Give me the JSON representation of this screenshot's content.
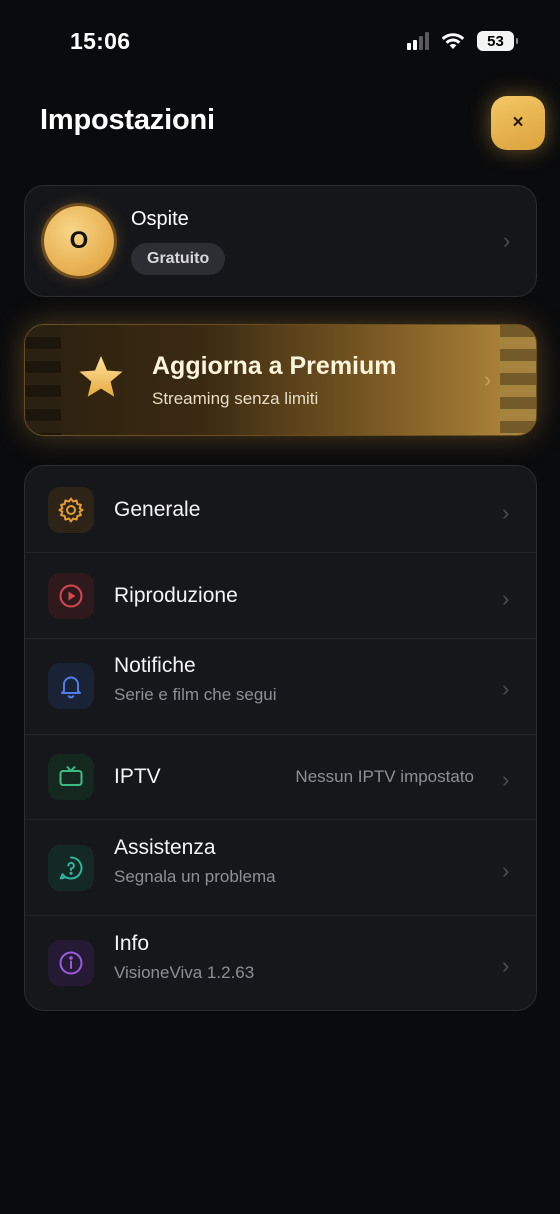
{
  "status_bar": {
    "time": "15:06",
    "battery": "53"
  },
  "header": {
    "title": "Impostazioni",
    "close_label": "×"
  },
  "profile": {
    "initial": "O",
    "name": "Ospite",
    "plan": "Gratuito"
  },
  "premium": {
    "title": "Aggiorna a Premium",
    "subtitle": "Streaming senza limiti"
  },
  "chevron": "›",
  "settings": [
    {
      "icon": "gear-icon",
      "title": "Generale",
      "subtitle": "",
      "value": "",
      "color": "#e39b3a"
    },
    {
      "icon": "play-circle-icon",
      "title": "Riproduzione",
      "subtitle": "",
      "value": "",
      "color": "#d9474e"
    },
    {
      "icon": "bell-icon",
      "title": "Notifiche",
      "subtitle": "Serie e film che segui",
      "value": "",
      "color": "#4f7de8"
    },
    {
      "icon": "tv-icon",
      "title": "IPTV",
      "subtitle": "",
      "value": "Nessun IPTV impostato",
      "color": "#3dbb84"
    },
    {
      "icon": "help-chat-icon",
      "title": "Assistenza",
      "subtitle": "Segnala un problema",
      "value": "",
      "color": "#2fb39c"
    },
    {
      "icon": "info-icon",
      "title": "Info",
      "subtitle": "VisioneViva 1.2.63",
      "value": "",
      "color": "#9b5be0"
    }
  ]
}
